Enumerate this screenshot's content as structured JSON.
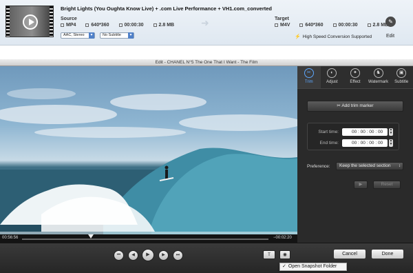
{
  "conversion": {
    "file_name": "Bright Lights (You Oughta Know Live)  + .com Live Performance + VH1.com_converted",
    "source_label": "Source",
    "target_label": "Target",
    "source": {
      "format": "MP4",
      "resolution": "640*360",
      "duration": "00:00:30",
      "size": "2.8 MB"
    },
    "target": {
      "format": "M4V",
      "resolution": "640*360",
      "duration": "00:00:30",
      "size": "2.8 MB"
    },
    "audio_select": "AAC, Stereo",
    "subtitle_select": "No Subtitle",
    "high_speed": "High Speed Conversion Supported",
    "edit_label": "Edit"
  },
  "editor": {
    "window_title": "Edit - CHANEL N°5  The One That I Want - The Film",
    "tabs": [
      {
        "label": "Trim",
        "icon": "scissors-icon"
      },
      {
        "label": "Adjust",
        "icon": "adjust-icon"
      },
      {
        "label": "Effect",
        "icon": "effect-icon"
      },
      {
        "label": "Watermark",
        "icon": "watermark-icon"
      },
      {
        "label": "Subtitle",
        "icon": "subtitle-icon"
      }
    ],
    "active_tab": "Trim",
    "add_trim_label": "Add trim marker",
    "start_time_label": "Start time:",
    "start_time": "00 : 00 : 00 : 00",
    "end_time_label": "End time:",
    "end_time": "00 : 00 : 00 : 00",
    "preference_label": "Preference:",
    "preference_value": "Keep the selected section",
    "reset_label": "Reset",
    "time_elapsed": "00:56:56",
    "time_remaining": "−00:02:20",
    "playhead_fraction": 0.28
  },
  "bottom": {
    "text_button": "T",
    "cancel_label": "Cancel",
    "done_label": "Done",
    "menu_item": "Open Snapshot Folder"
  }
}
